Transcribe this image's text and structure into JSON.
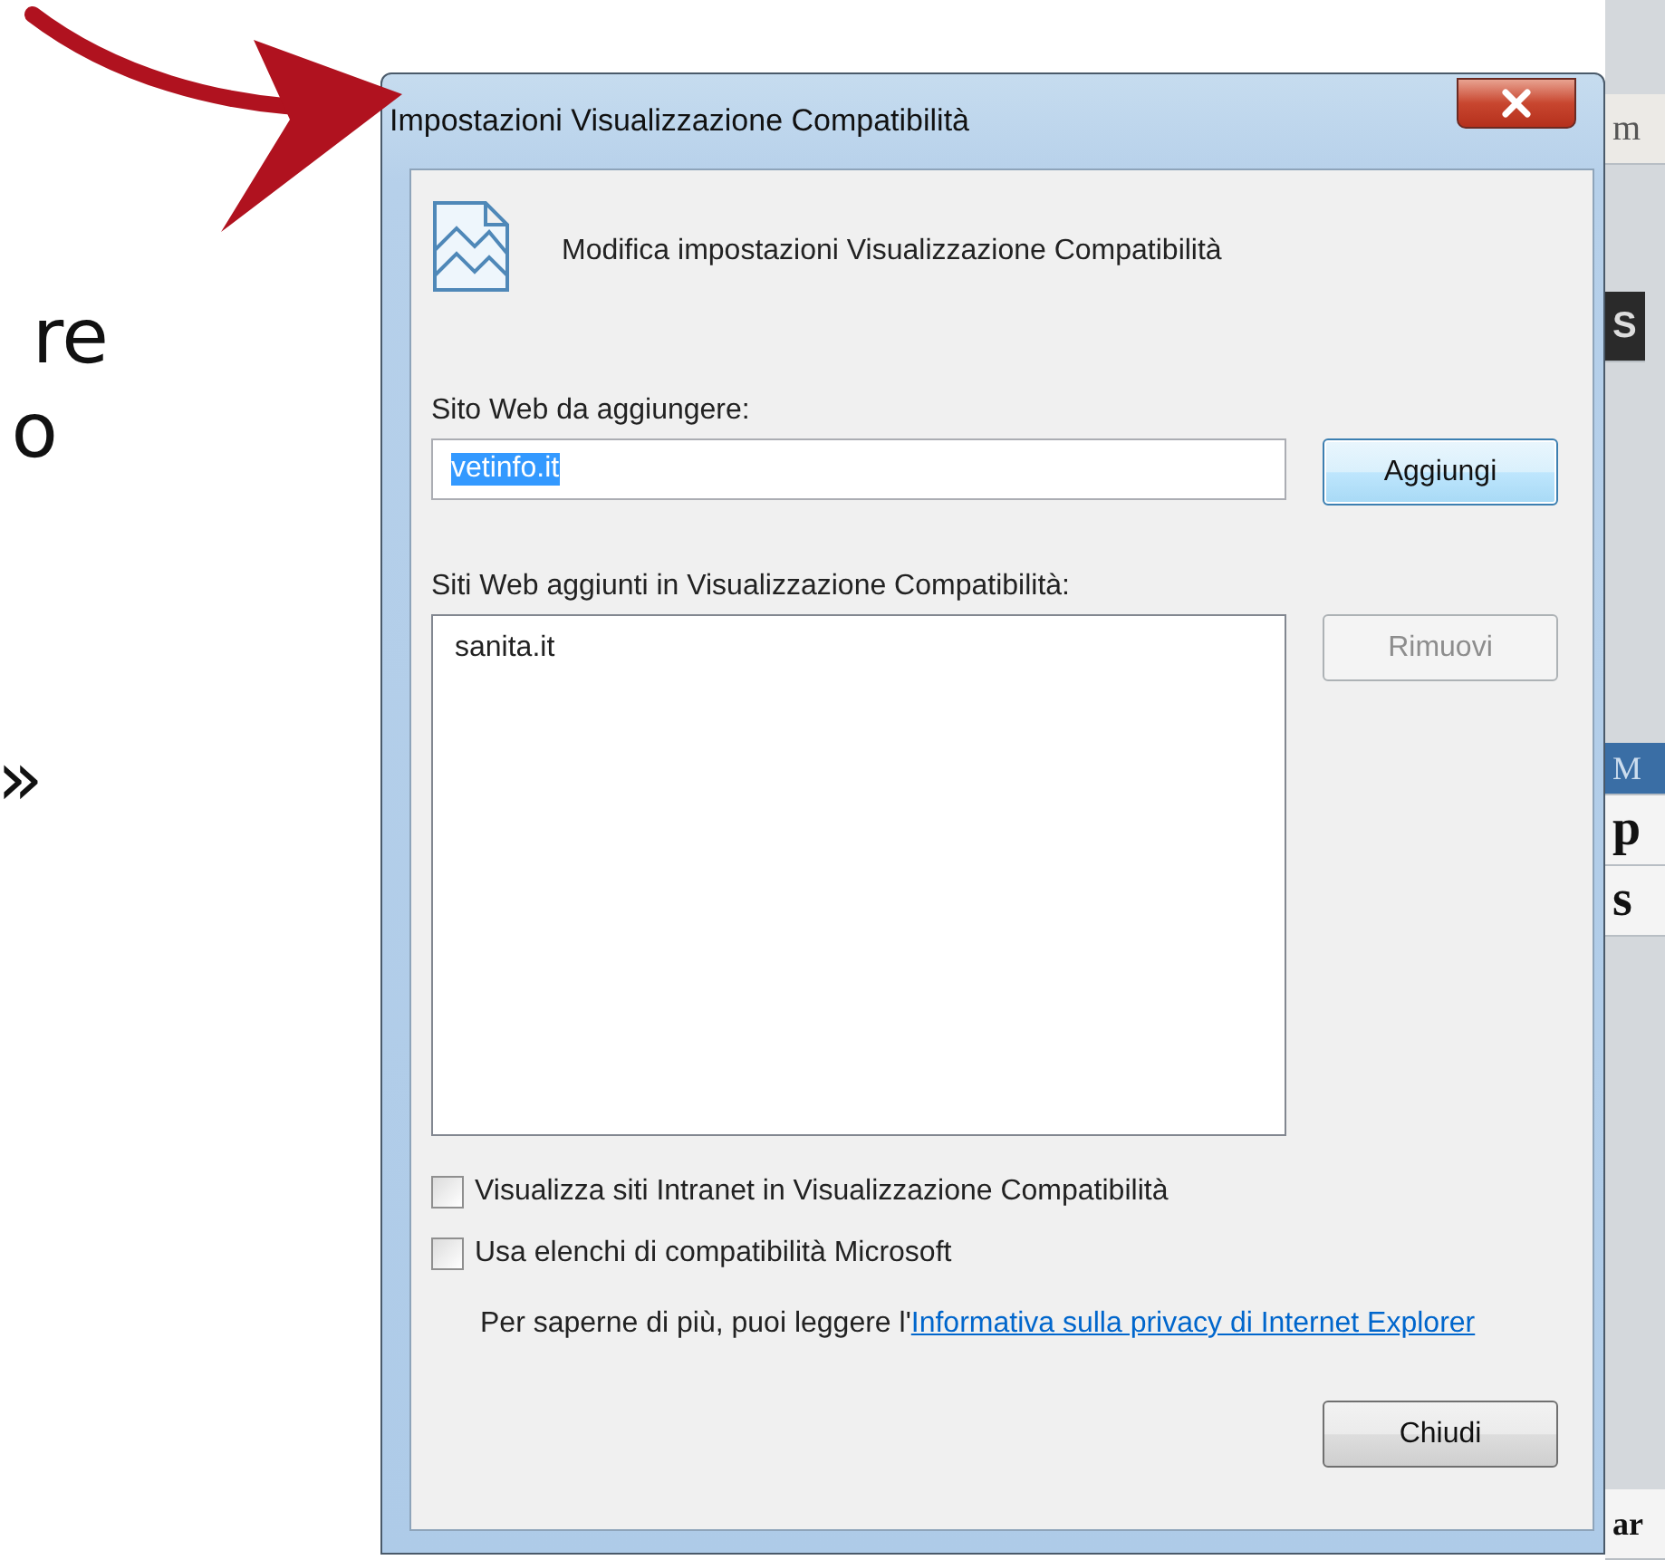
{
  "slide_text": [
    "re",
    "o",
    "»"
  ],
  "dialog": {
    "title": "Impostazioni Visualizzazione Compatibilità",
    "heading": "Modifica impostazioni Visualizzazione Compatibilità",
    "add_label": "Sito Web da aggiungere:",
    "add_field": {
      "value": "vetinfo.it",
      "text_selected": true
    },
    "add_button": {
      "label": "Aggiungi",
      "disabled": false
    },
    "list_label": "Siti Web aggiunti in Visualizzazione Compatibilità:",
    "sites": [
      {
        "label": "sanita.it",
        "selected": false
      }
    ],
    "remove_button": {
      "label": "Rimuovi",
      "disabled": true
    },
    "checkboxes": [
      {
        "label": "Visualizza siti Intranet in Visualizzazione Compatibilità",
        "checked": false
      },
      {
        "label": "Usa elenchi di compatibilità Microsoft",
        "checked": false
      }
    ],
    "info": {
      "text": "Per saperne di più, puoi leggere l'",
      "link": "Informativa sulla privacy di Internet Explorer"
    },
    "close_button": {
      "label": "Chiudi",
      "disabled": false
    }
  },
  "background_page": [
    {
      "text": "m",
      "kind": "plain"
    },
    {
      "text": "S",
      "kind": "dark"
    },
    {
      "text": "M",
      "kind": "blue"
    },
    {
      "text": "p",
      "kind": "bold"
    },
    {
      "text": "s",
      "kind": "bold"
    },
    {
      "text": "ar",
      "kind": "bold"
    }
  ]
}
